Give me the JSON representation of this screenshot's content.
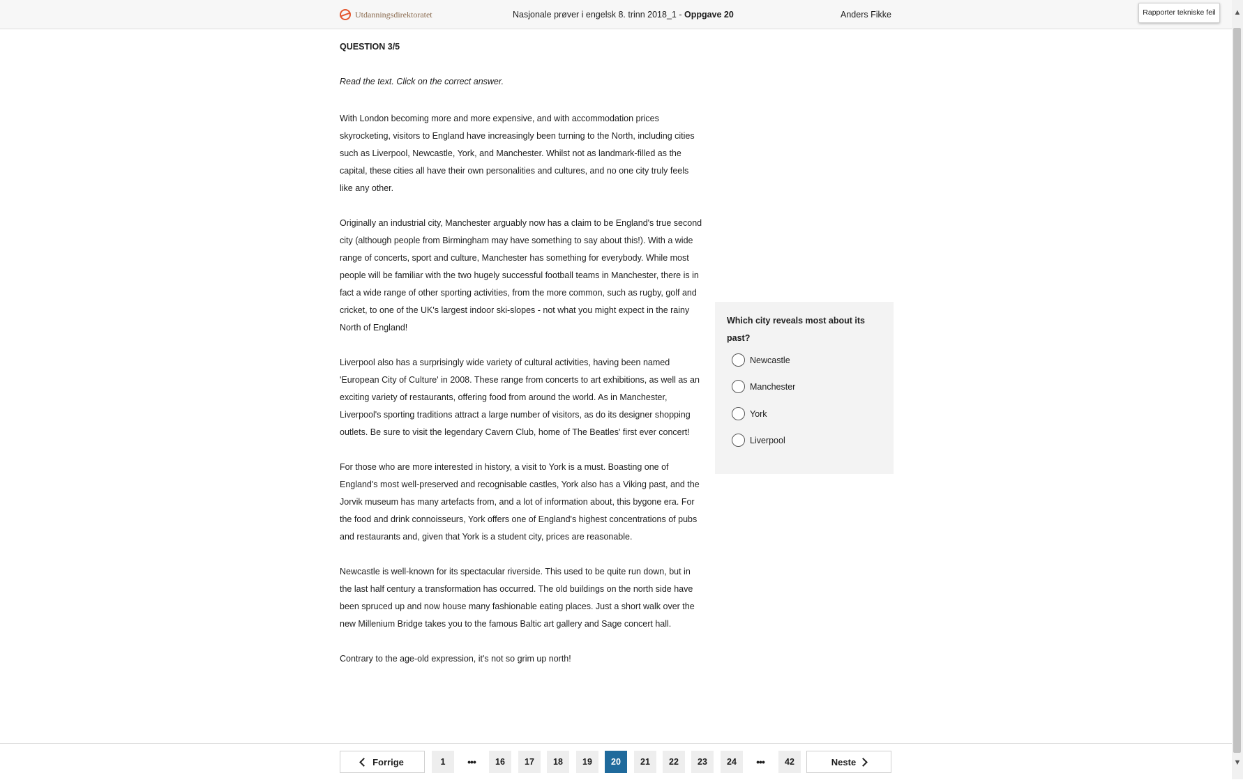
{
  "header": {
    "logo_text": "Utdanningsdirektoratet",
    "title_prefix": "Nasjonale prøver i engelsk 8. trinn 2018_1 - ",
    "title_task": "Oppgave 20",
    "user": "Anders Fikke",
    "report_button": "Rapporter tekniske feil"
  },
  "question_number": "QUESTION 3/5",
  "instruction": "Read the text. Click on the correct answer.",
  "paragraphs": [
    "With London becoming more and more expensive, and with accommodation prices skyrocketing, visitors to England have increasingly been turning to the North, including cities such as Liverpool, Newcastle, York, and Manchester. Whilst not as landmark-filled as the capital, these cities all have their own personalities and cultures, and no one city truly feels like any other.",
    "Originally an industrial city, Manchester arguably now has a claim to be England's true second city (although people from Birmingham may have something to say about this!). With a wide range of concerts, sport and culture, Manchester has something for everybody. While most people will be familiar with the two hugely successful football teams in Manchester, there is in fact a wide range of other sporting activities, from the more common, such as rugby, golf and cricket, to one of the UK's largest indoor ski-slopes - not what you might expect in the rainy North of England!",
    "Liverpool also has a surprisingly wide variety of cultural activities, having been named 'European City of Culture' in 2008. These range from concerts to art exhibitions, as well as an exciting variety of restaurants, offering food from around the world. As in Manchester, Liverpool's sporting traditions attract a large number of visitors, as do its designer shopping outlets. Be sure to visit the legendary Cavern Club, home of The Beatles' first ever concert!",
    "For those who are more interested in history, a visit to York is a must. Boasting one of England's most well-preserved and recognisable castles, York also has a Viking past, and the Jorvik museum has many artefacts from, and a lot of information about, this bygone era. For the food and drink connoisseurs, York offers one of England's highest concentrations of pubs and restaurants and, given that York is a student city, prices are reasonable.",
    "Newcastle is well-known for its spectacular riverside. This used to be quite run down, but in the last half century a transformation has occurred. The old buildings on the north side have been spruced up and now house many fashionable eating places. Just a short walk over the new Millenium Bridge takes you to the famous Baltic art gallery and Sage concert hall.",
    "Contrary to the age-old expression, it's not so grim up north!"
  ],
  "question": {
    "text": "Which city reveals most about its past?",
    "options": [
      "Newcastle",
      "Manchester",
      "York",
      "Liverpool"
    ]
  },
  "pagination": {
    "prev_label": "Forrige",
    "next_label": "Neste",
    "pages": [
      "1",
      "•••",
      "16",
      "17",
      "18",
      "19",
      "20",
      "21",
      "22",
      "23",
      "24",
      "•••",
      "42"
    ],
    "current": "20"
  },
  "colors": {
    "active_page": "#1f6a9c",
    "logo_accent": "#e4572e"
  }
}
